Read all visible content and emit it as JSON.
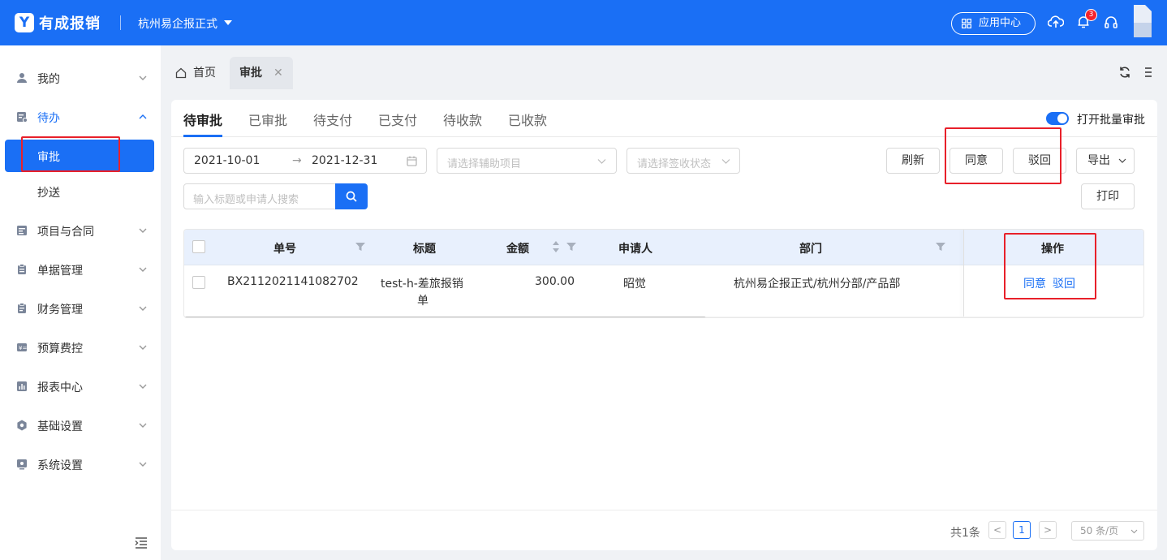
{
  "topbar": {
    "logo_glyph": "Y",
    "brand": "有成报销",
    "org": "杭州易企报正式",
    "app_center": "应用中心",
    "notification_count": "3",
    "icons": [
      "grid-icon",
      "cloud-upload-icon",
      "bell-icon",
      "headset-icon",
      "avatar"
    ]
  },
  "sidebar": {
    "items": [
      {
        "label": "我的",
        "icon": "user-icon",
        "expanded": false
      },
      {
        "label": "待办",
        "icon": "todo-icon",
        "expanded": true,
        "children": [
          {
            "label": "审批",
            "active": true
          },
          {
            "label": "抄送",
            "active": false
          }
        ]
      },
      {
        "label": "项目与合同",
        "icon": "project-icon",
        "expanded": false
      },
      {
        "label": "单据管理",
        "icon": "document-icon",
        "expanded": false
      },
      {
        "label": "财务管理",
        "icon": "finance-icon",
        "expanded": false
      },
      {
        "label": "预算费控",
        "icon": "budget-icon",
        "expanded": false
      },
      {
        "label": "报表中心",
        "icon": "report-icon",
        "expanded": false
      },
      {
        "label": "基础设置",
        "icon": "gear-icon",
        "expanded": false
      },
      {
        "label": "系统设置",
        "icon": "system-icon",
        "expanded": false
      }
    ]
  },
  "page_tabs": [
    {
      "label": "首页",
      "icon": "home-icon",
      "active": false
    },
    {
      "label": "审批",
      "active": true,
      "closable": true,
      "close_glyph": "✕"
    }
  ],
  "sub_tabs": [
    "待审批",
    "已审批",
    "待支付",
    "已支付",
    "待收款",
    "已收款"
  ],
  "batch_toggle": {
    "label": "打开批量审批",
    "on": true
  },
  "filters": {
    "date_start": "2021-10-01",
    "date_arrow": "→",
    "date_end": "2021-12-31",
    "aux_placeholder": "请选择辅助项目",
    "sign_placeholder": "请选择签收状态",
    "search_placeholder": "输入标题或申请人搜索"
  },
  "toolbar": {
    "refresh": "刷新",
    "agree": "同意",
    "reject": "驳回",
    "export": "导出",
    "print": "打印"
  },
  "table": {
    "columns": [
      "单号",
      "标题",
      "金额",
      "申请人",
      "部门",
      "操作"
    ],
    "rows": [
      {
        "no": "BX2112021141082702",
        "title_line1": "test-h-差旅报销",
        "title_line2": "单",
        "amount": "300.00",
        "applicant": "昭觉",
        "dept": "杭州易企报正式/杭州分部/产品部",
        "actions": [
          "同意",
          "驳回"
        ]
      }
    ]
  },
  "pagination": {
    "total": "共1条",
    "prev": "<",
    "current": "1",
    "next": ">",
    "page_size": "50 条/页"
  },
  "colors": {
    "primary": "#1a6ff5",
    "annotation": "#e8202a",
    "header_bg": "#e8f0fd"
  }
}
